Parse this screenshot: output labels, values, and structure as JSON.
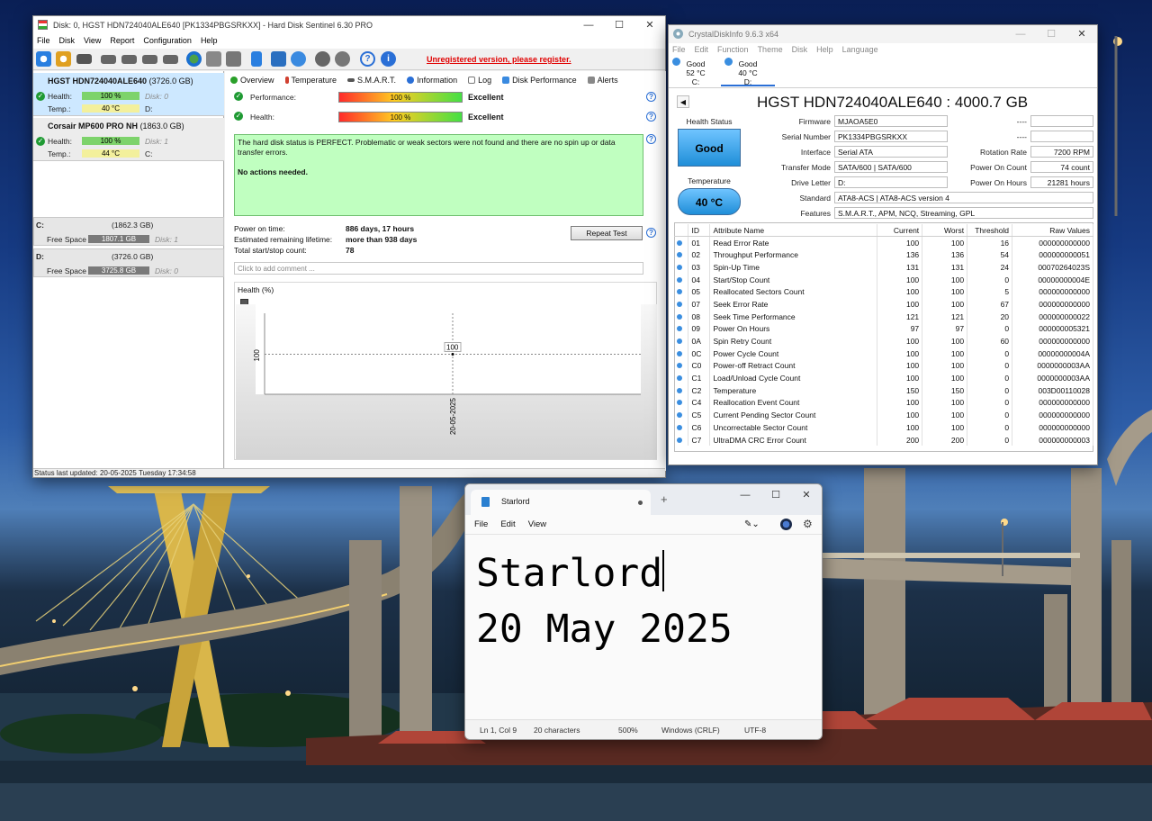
{
  "hds": {
    "title": "Disk: 0, HGST HDN724040ALE640 [PK1334PBGSRKXX]  -  Hard Disk Sentinel 6.30 PRO",
    "menu": [
      "File",
      "Disk",
      "View",
      "Report",
      "Configuration",
      "Help"
    ],
    "unregistered": "Unregistered version, please register.",
    "disks": [
      {
        "name": "HGST HDN724040ALE640",
        "size": "(3726.0 GB)",
        "health_label": "Health:",
        "health": "100 %",
        "disk_label": "Disk: 0",
        "temp_label": "Temp.:",
        "temp": "40 °C",
        "drive": "D:",
        "selected": true
      },
      {
        "name": "Corsair MP600 PRO NH",
        "size": "(1863.0 GB)",
        "health_label": "Health:",
        "health": "100 %",
        "disk_label": "Disk: 1",
        "temp_label": "Temp.:",
        "temp": "44 °C",
        "drive": "C:",
        "selected": false
      }
    ],
    "drives": [
      {
        "letter": "C:",
        "size": "(1862.3 GB)",
        "free_label": "Free Space",
        "free": "1807.1 GB",
        "disk": "Disk: 1"
      },
      {
        "letter": "D:",
        "size": "(3726.0 GB)",
        "free_label": "Free Space",
        "free": "3725.8 GB",
        "disk": "Disk: 0"
      }
    ],
    "tabs": [
      "Overview",
      "Temperature",
      "S.M.A.R.T.",
      "Information",
      "Log",
      "Disk Performance",
      "Alerts"
    ],
    "performance_label": "Performance:",
    "performance_value": "100 %",
    "performance_verdict": "Excellent",
    "health_label": "Health:",
    "health_value": "100 %",
    "health_verdict": "Excellent",
    "status_message": "The hard disk status is PERFECT. Problematic or weak sectors were not found and there are no spin up or data transfer errors.",
    "actions": "No actions needed.",
    "power_on_label": "Power on time:",
    "power_on_value": "886 days, 17 hours",
    "remaining_label": "Estimated remaining lifetime:",
    "remaining_value": "more than 938 days",
    "startstop_label": "Total start/stop count:",
    "startstop_value": "78",
    "repeat_test": "Repeat Test",
    "comment_placeholder": "Click to add comment ...",
    "chart_title": "Health (%)",
    "statusbar": "Status last updated: 20-05-2025 Tuesday 17:34:58"
  },
  "chart_data": {
    "type": "line",
    "title": "Health (%)",
    "x": [
      "20-05-2025"
    ],
    "series": [
      {
        "values": [
          100
        ]
      }
    ],
    "ytick": "100",
    "data_label": "100",
    "xtick": "20-05-2025"
  },
  "cdi": {
    "title": "CrystalDiskInfo 9.6.3 x64",
    "menu": [
      "File",
      "Edit",
      "Function",
      "Theme",
      "Disk",
      "Help",
      "Language"
    ],
    "drives": [
      {
        "status": "Good",
        "temp": "52 °C",
        "letter": "C:"
      },
      {
        "status": "Good",
        "temp": "40 °C",
        "letter": "D:"
      }
    ],
    "model": "HGST HDN724040ALE640 : 4000.7 GB",
    "health_status_label": "Health Status",
    "health_status": "Good",
    "temperature_label": "Temperature",
    "temperature": "40 °C",
    "firmware_label": "Firmware",
    "firmware": "MJAOA5E0",
    "serial_label": "Serial Number",
    "serial": "PK1334PBGSRKXX",
    "interface_label": "Interface",
    "interface": "Serial ATA",
    "transfer_label": "Transfer Mode",
    "transfer": "SATA/600 | SATA/600",
    "driveletter_label": "Drive Letter",
    "driveletter": "D:",
    "standard_label": "Standard",
    "standard": "ATA8-ACS | ATA8-ACS version 4",
    "features_label": "Features",
    "features": "S.M.A.R.T., APM, NCQ, Streaming, GPL",
    "dash1": "----",
    "dash2": "----",
    "rotation_label": "Rotation Rate",
    "rotation": "7200 RPM",
    "poweroncount_label": "Power On Count",
    "poweroncount": "74 count",
    "poweronhours_label": "Power On Hours",
    "poweronhours": "21281 hours",
    "smart_headers": [
      "ID",
      "Attribute Name",
      "Current",
      "Worst",
      "Threshold",
      "Raw Values"
    ],
    "smart": [
      [
        "01",
        "Read Error Rate",
        "100",
        "100",
        "16",
        "000000000000"
      ],
      [
        "02",
        "Throughput Performance",
        "136",
        "136",
        "54",
        "000000000051"
      ],
      [
        "03",
        "Spin-Up Time",
        "131",
        "131",
        "24",
        "00070264023S"
      ],
      [
        "04",
        "Start/Stop Count",
        "100",
        "100",
        "0",
        "00000000004E"
      ],
      [
        "05",
        "Reallocated Sectors Count",
        "100",
        "100",
        "5",
        "000000000000"
      ],
      [
        "07",
        "Seek Error Rate",
        "100",
        "100",
        "67",
        "000000000000"
      ],
      [
        "08",
        "Seek Time Performance",
        "121",
        "121",
        "20",
        "000000000022"
      ],
      [
        "09",
        "Power On Hours",
        "97",
        "97",
        "0",
        "000000005321"
      ],
      [
        "0A",
        "Spin Retry Count",
        "100",
        "100",
        "60",
        "000000000000"
      ],
      [
        "0C",
        "Power Cycle Count",
        "100",
        "100",
        "0",
        "00000000004A"
      ],
      [
        "C0",
        "Power-off Retract Count",
        "100",
        "100",
        "0",
        "0000000003AA"
      ],
      [
        "C1",
        "Load/Unload Cycle Count",
        "100",
        "100",
        "0",
        "0000000003AA"
      ],
      [
        "C2",
        "Temperature",
        "150",
        "150",
        "0",
        "003D00110028"
      ],
      [
        "C4",
        "Reallocation Event Count",
        "100",
        "100",
        "0",
        "000000000000"
      ],
      [
        "C5",
        "Current Pending Sector Count",
        "100",
        "100",
        "0",
        "000000000000"
      ],
      [
        "C6",
        "Uncorrectable Sector Count",
        "100",
        "100",
        "0",
        "000000000000"
      ],
      [
        "C7",
        "UltraDMA CRC Error Count",
        "200",
        "200",
        "0",
        "000000000003"
      ]
    ]
  },
  "notepad": {
    "tab_title": "Starlord",
    "menu": [
      "File",
      "Edit",
      "View"
    ],
    "line1": "Starlord",
    "line2": "20 May 2025",
    "status_pos": "Ln 1, Col 9",
    "status_chars": "20 characters",
    "status_zoom": "500%",
    "status_eol": "Windows (CRLF)",
    "status_enc": "UTF-8"
  },
  "colors": {
    "accent": "#2a6fd6",
    "good_green": "#1f9a33",
    "error_red": "#e00000",
    "cdi_blue": "#1f8ed8"
  }
}
